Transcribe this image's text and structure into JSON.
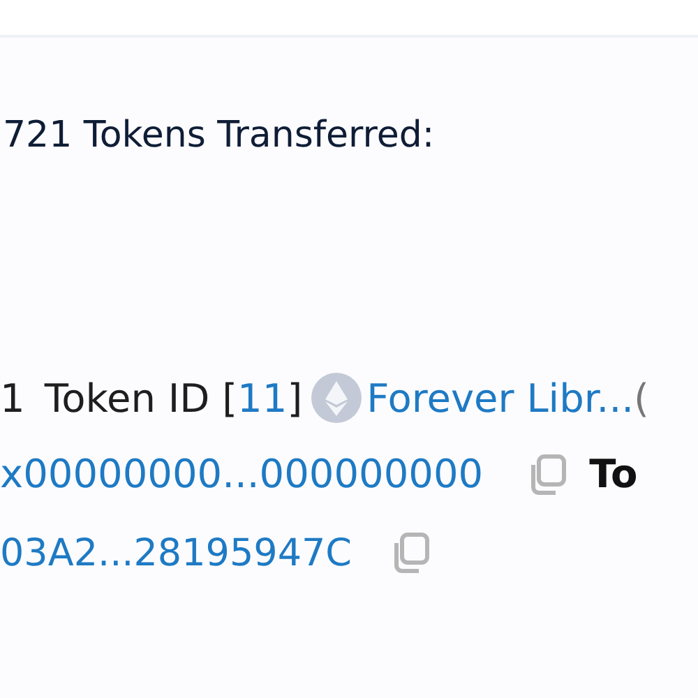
{
  "heading": "721 Tokens Transferred:",
  "transfer": {
    "count": "1",
    "token_label": "Token ID [",
    "token_id": "11",
    "token_close": "]",
    "token_name": "Forever Libr...",
    "paren": "(",
    "from_address": "x00000000...000000000",
    "to_label": "To",
    "to_address": "03A2...28195947C"
  }
}
